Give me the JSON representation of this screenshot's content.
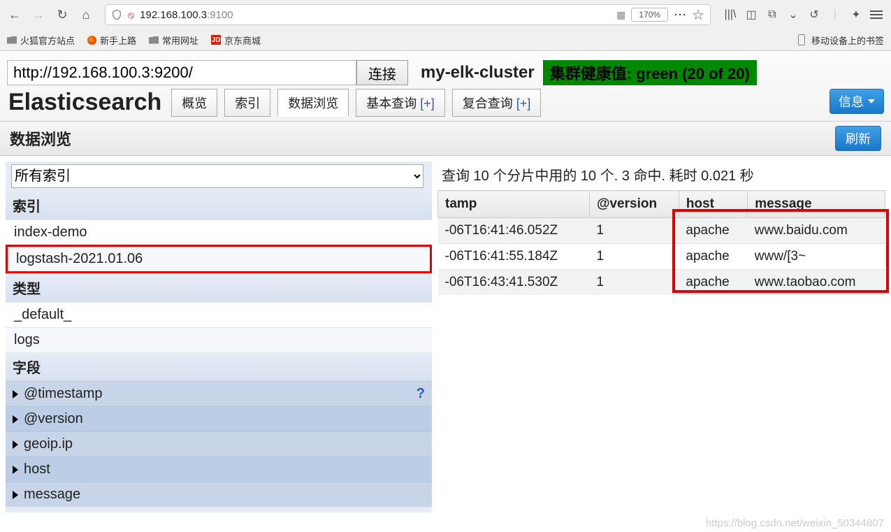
{
  "browser": {
    "url_display_host": "192.168.100.3",
    "url_display_port": ":9100",
    "zoom": "170%",
    "bookmarks": {
      "b1": "火狐官方站点",
      "b2": "新手上路",
      "b3": "常用网址",
      "b4_logo": "JD",
      "b4": "京东商城",
      "mobile": "移动设备上的书签"
    }
  },
  "app": {
    "es_url": "http://192.168.100.3:9200/",
    "connect_label": "连接",
    "cluster_name": "my-elk-cluster",
    "health_label": "集群健康值: green (20 of 20)",
    "title": "Elasticsearch",
    "tabs": {
      "overview": "概览",
      "indices": "索引",
      "browse": "数据浏览",
      "basic": "基本查询 ",
      "compound": "复合查询 ",
      "plus": "[+]"
    },
    "info": "信息",
    "subheader_title": "数据浏览",
    "refresh": "刷新"
  },
  "left": {
    "all_indices": "所有索引",
    "label_index": "索引",
    "label_type": "类型",
    "label_fields": "字段",
    "indices": [
      "index-demo",
      "logstash-2021.01.06"
    ],
    "types": [
      "_default_",
      "logs"
    ],
    "fields": [
      "@timestamp",
      "@version",
      "geoip.ip",
      "host",
      "message"
    ],
    "qmark": "?"
  },
  "results": {
    "summary": "查询 10 个分片中用的 10 个. 3 命中. 耗时 0.021 秒",
    "headers": {
      "ts": "tamp",
      "ver": "@version",
      "host": "host",
      "msg": "message"
    },
    "rows": [
      {
        "ts": "-06T16:41:46.052Z",
        "ver": "1",
        "host": "apache",
        "msg": "www.baidu.com"
      },
      {
        "ts": "-06T16:41:55.184Z",
        "ver": "1",
        "host": "apache",
        "msg": "www/[3~"
      },
      {
        "ts": "-06T16:43:41.530Z",
        "ver": "1",
        "host": "apache",
        "msg": "www.taobao.com"
      }
    ]
  },
  "watermark": "https://blog.csdn.net/weixin_50344807"
}
